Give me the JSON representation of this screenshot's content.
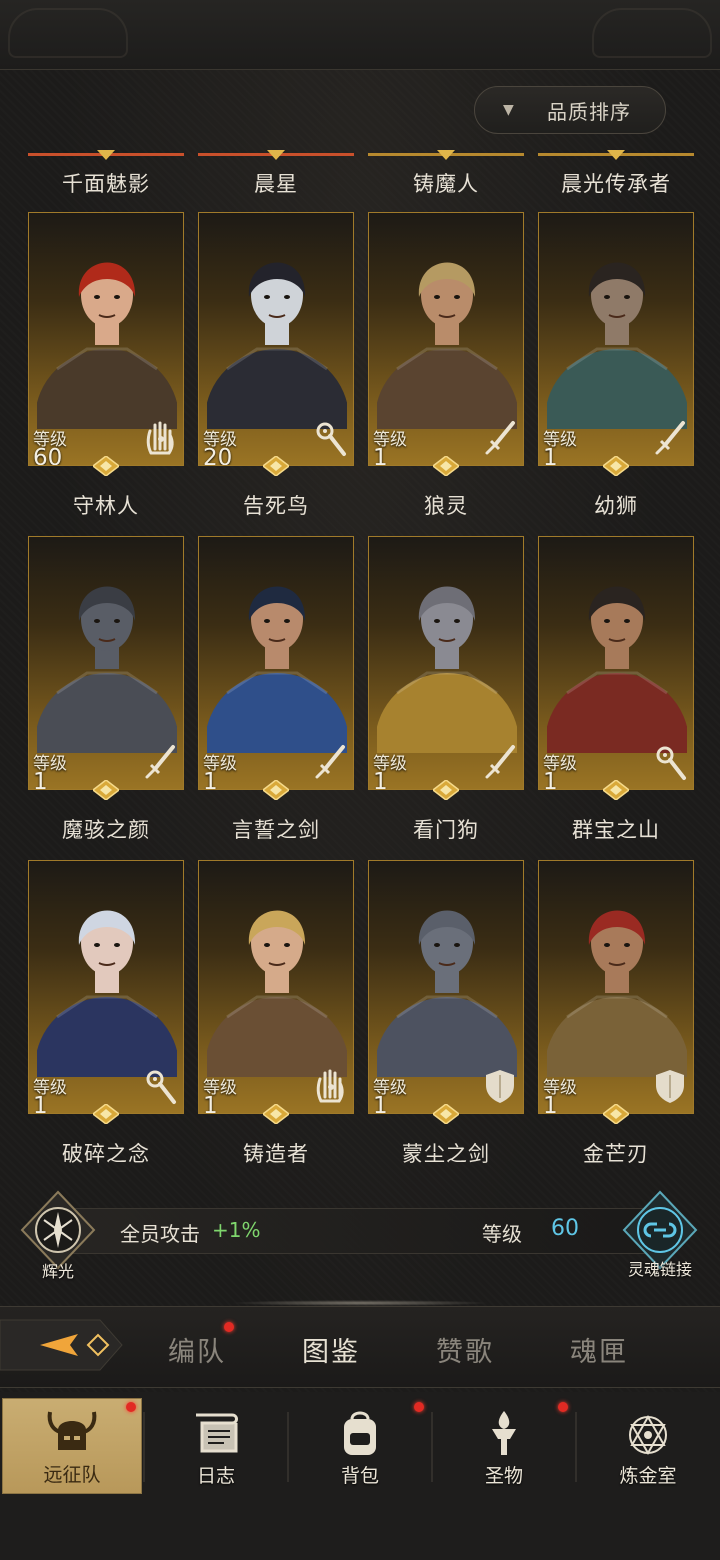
{
  "sort": {
    "label": "品质排序"
  },
  "top_row": [
    {
      "name": "千面魅影",
      "accent": "#c9502b"
    },
    {
      "name": "晨星",
      "accent": "#c9502b"
    },
    {
      "name": "铸魔人",
      "accent": "#b7892e"
    },
    {
      "name": "晨光传承者",
      "accent": "#b7892e"
    }
  ],
  "level_word": "等级",
  "heroes": [
    {
      "name": "守林人",
      "level": "60",
      "class_icon": "hand-icon",
      "colors": {
        "hair": "#b02a1a",
        "skin": "#d9a98a",
        "outfit": "#4a3a2a"
      }
    },
    {
      "name": "告死鸟",
      "level": "20",
      "class_icon": "staff-icon",
      "colors": {
        "hair": "#23232b",
        "skin": "#cfd3d8",
        "outfit": "#2b2c34"
      }
    },
    {
      "name": "狼灵",
      "level": "1",
      "class_icon": "sword-icon",
      "colors": {
        "hair": "#b59a62",
        "skin": "#b98c6a",
        "outfit": "#5a4430"
      }
    },
    {
      "name": "幼狮",
      "level": "1",
      "class_icon": "sword-icon",
      "colors": {
        "hair": "#2a2420",
        "skin": "#8f7a68",
        "outfit": "#3a5a56"
      }
    },
    {
      "name": "魔骇之颜",
      "level": "1",
      "class_icon": "sword-icon",
      "colors": {
        "hair": "#3a3d44",
        "skin": "#595d66",
        "outfit": "#4a4d55"
      }
    },
    {
      "name": "言誓之剑",
      "level": "1",
      "class_icon": "sword-icon",
      "colors": {
        "hair": "#1f2a40",
        "skin": "#b88a6c",
        "outfit": "#2f4f8a"
      }
    },
    {
      "name": "看门狗",
      "level": "1",
      "class_icon": "sword-icon",
      "colors": {
        "hair": "#6e6e76",
        "skin": "#8a8a92",
        "outfit": "#a7822f"
      }
    },
    {
      "name": "群宝之山",
      "level": "1",
      "class_icon": "staff-icon",
      "colors": {
        "hair": "#2a2420",
        "skin": "#a77a5a",
        "outfit": "#7a2a22"
      }
    },
    {
      "name": "破碎之念",
      "level": "1",
      "class_icon": "staff-icon",
      "colors": {
        "hair": "#cfd6e2",
        "skin": "#e2c9bd",
        "outfit": "#2b3560"
      }
    },
    {
      "name": "铸造者",
      "level": "1",
      "class_icon": "hand-icon",
      "colors": {
        "hair": "#c9a65a",
        "skin": "#d5aa8a",
        "outfit": "#6a4f34"
      }
    },
    {
      "name": "蒙尘之剑",
      "level": "1",
      "class_icon": "shield-icon",
      "colors": {
        "hair": "#5a5f6a",
        "skin": "#6a6f7a",
        "outfit": "#4d5260"
      }
    },
    {
      "name": "金芒刃",
      "level": "1",
      "class_icon": "shield-icon",
      "colors": {
        "hair": "#9a2a22",
        "skin": "#a87a5a",
        "outfit": "#7a6238"
      }
    }
  ],
  "bonus": {
    "label": "全员攻击",
    "value": "+1%",
    "level_label": "等级",
    "level_value": "60",
    "left_badge": "辉光",
    "right_badge": "灵魂链接"
  },
  "tabs": [
    {
      "label": "编队",
      "active": false,
      "dot": true
    },
    {
      "label": "图鉴",
      "active": true,
      "dot": false
    },
    {
      "label": "赞歌",
      "active": false,
      "dot": false
    },
    {
      "label": "魂匣",
      "active": false,
      "dot": false
    }
  ],
  "nav": [
    {
      "label": "远征队",
      "icon": "horned-helmet-icon",
      "active": true,
      "dot": true
    },
    {
      "label": "日志",
      "icon": "scroll-icon",
      "active": false,
      "dot": false
    },
    {
      "label": "背包",
      "icon": "backpack-icon",
      "active": false,
      "dot": true
    },
    {
      "label": "圣物",
      "icon": "torch-icon",
      "active": false,
      "dot": true
    },
    {
      "label": "炼金室",
      "icon": "alchemy-icon",
      "active": false,
      "dot": false
    }
  ],
  "colors": {
    "accent_gold": "#a07a2a",
    "bonus_green": "#7fd66d",
    "level_blue": "#5fc6e6",
    "notify_red": "#e22a23"
  }
}
